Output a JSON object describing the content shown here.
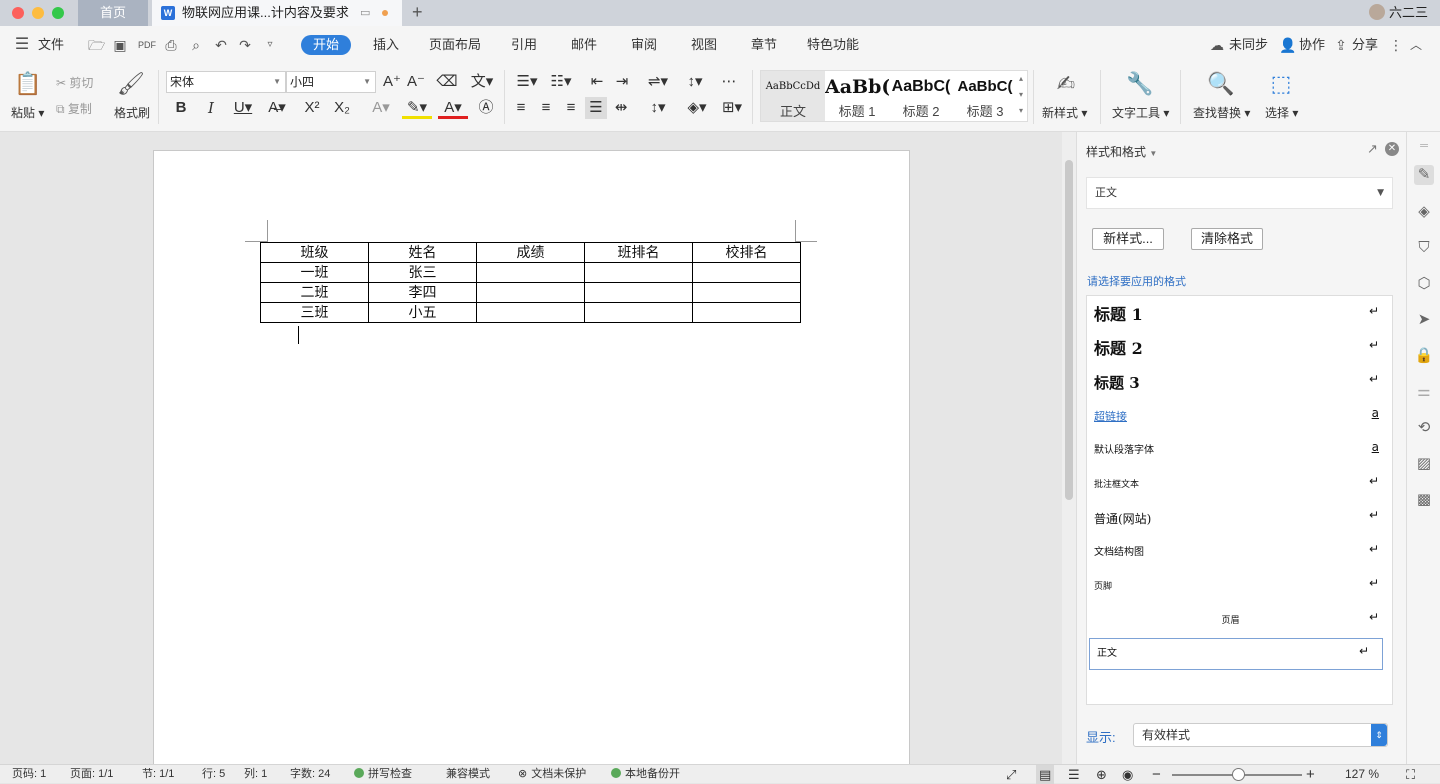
{
  "titlebar": {
    "home_tab": "首页",
    "doc_tab": "物联网应用课...计内容及要求",
    "doc_icon_glyph": "W",
    "user_name": "六二三"
  },
  "menubar": {
    "file": "文件",
    "tabs": [
      "开始",
      "插入",
      "页面布局",
      "引用",
      "邮件",
      "审阅",
      "视图",
      "章节",
      "特色功能"
    ],
    "active_tab": "开始",
    "sync": "未同步",
    "collab": "协作",
    "share": "分享"
  },
  "ribbon": {
    "paste": "粘贴",
    "cut": "剪切",
    "copy": "复制",
    "format_painter": "格式刷",
    "font_name": "宋体",
    "font_size": "小四",
    "styles": [
      {
        "preview": "AaBbCcDd",
        "name": "正文"
      },
      {
        "preview": "AaBb(",
        "name": "标题 1"
      },
      {
        "preview": "AaBbC(",
        "name": "标题 2"
      },
      {
        "preview": "AaBbC(",
        "name": "标题 3"
      }
    ],
    "new_style": "新样式",
    "text_tools": "文字工具",
    "find_replace": "查找替换",
    "select": "选择"
  },
  "document": {
    "table": [
      [
        "班级",
        "姓名",
        "成绩",
        "班排名",
        "校排名"
      ],
      [
        "一班",
        "张三",
        "",
        "",
        ""
      ],
      [
        "二班",
        "李四",
        "",
        "",
        ""
      ],
      [
        "三班",
        "小五",
        "",
        "",
        ""
      ]
    ]
  },
  "panel": {
    "title": "样式和格式",
    "current_style": "正文",
    "new_style_btn": "新样式...",
    "clear_format_btn": "清除格式",
    "hint": "请选择要应用的格式",
    "styles": [
      {
        "label": "标题 1",
        "mark": "↵"
      },
      {
        "label": "标题 2",
        "mark": "↵"
      },
      {
        "label": "标题 3",
        "mark": "↵"
      },
      {
        "label": "超链接",
        "mark": "a"
      },
      {
        "label": "默认段落字体",
        "mark": "a"
      },
      {
        "label": "批注框文本",
        "mark": "↵"
      },
      {
        "label": "普通(网站)",
        "mark": "↵"
      },
      {
        "label": "文档结构图",
        "mark": "↵"
      },
      {
        "label": "页脚",
        "mark": "↵"
      },
      {
        "label": "页眉",
        "mark": "↵"
      },
      {
        "label": "正文",
        "mark": "↵"
      }
    ],
    "show_label": "显示:",
    "show_value": "有效样式"
  },
  "statusbar": {
    "page_num": "页码: 1",
    "pages": "页面: 1/1",
    "section": "节: 1/1",
    "row": "行: 5",
    "col": "列: 1",
    "words": "字数: 24",
    "spell": "拼写检查",
    "compat": "兼容模式",
    "protect": "文档未保护",
    "backup": "本地备份开",
    "zoom": "127 %"
  }
}
